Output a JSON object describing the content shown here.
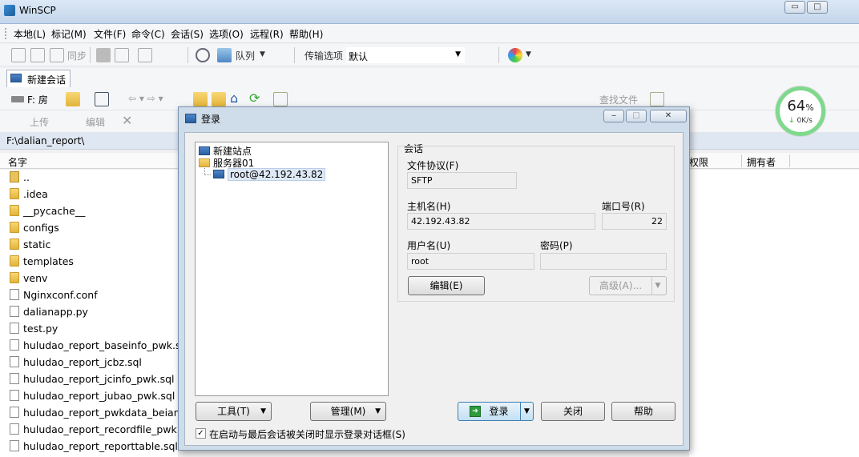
{
  "app": {
    "title": "WinSCP",
    "window_buttons": [
      "▭",
      "□"
    ]
  },
  "menu": [
    "本地(L)",
    "标记(M)",
    "文件(F)",
    "命令(C)",
    "会话(S)",
    "选项(O)",
    "远程(R)",
    "帮助(H)"
  ],
  "toolbar1": {
    "sync_label": "同步",
    "queue_label": "队列",
    "transfer_label": "传输选项",
    "transfer_value": "默认"
  },
  "tab": {
    "label": "新建会话"
  },
  "local_toolbar": {
    "drive": "F: 房"
  },
  "toolbar3": {
    "upload_label": "上传",
    "edit_label": "编辑"
  },
  "remote_toolbar": {
    "find_label": "查找文件"
  },
  "local": {
    "path": "F:\\dalian_report\\",
    "column_name": "名字",
    "files": [
      {
        "name": "..",
        "type": "up"
      },
      {
        "name": ".idea",
        "type": "folder"
      },
      {
        "name": "__pycache__",
        "type": "folder"
      },
      {
        "name": "configs",
        "type": "folder"
      },
      {
        "name": "static",
        "type": "folder"
      },
      {
        "name": "templates",
        "type": "folder"
      },
      {
        "name": "venv",
        "type": "folder"
      },
      {
        "name": "Nginxconf.conf",
        "type": "file"
      },
      {
        "name": "dalianapp.py",
        "type": "file"
      },
      {
        "name": "test.py",
        "type": "file"
      },
      {
        "name": "huludao_report_baseinfo_pwk.sql",
        "type": "file"
      },
      {
        "name": "huludao_report_jcbz.sql",
        "type": "file"
      },
      {
        "name": "huludao_report_jcinfo_pwk.sql",
        "type": "file"
      },
      {
        "name": "huludao_report_jubao_pwk.sql",
        "type": "file"
      },
      {
        "name": "huludao_report_pwkdata_beian.sql",
        "type": "file"
      },
      {
        "name": "huludao_report_recordfile_pwk.sql",
        "type": "file"
      },
      {
        "name": "huludao_report_reporttable.sql",
        "type": "file"
      }
    ]
  },
  "remote": {
    "column_perm": "权限",
    "column_owner": "拥有者"
  },
  "speed": {
    "percent": "64",
    "percent_sign": "%",
    "rate": "0K/s"
  },
  "dialog": {
    "title": "登录",
    "tree": {
      "new_site": "新建站点",
      "folder": "服务器01",
      "site": "root@42.192.43.82"
    },
    "session_label": "会话",
    "protocol_label": "文件协议(F)",
    "protocol_value": "SFTP",
    "host_label": "主机名(H)",
    "host_value": "42.192.43.82",
    "port_label": "端口号(R)",
    "port_value": "22",
    "user_label": "用户名(U)",
    "user_value": "root",
    "password_label": "密码(P)",
    "password_value": "",
    "edit_button": "编辑(E)",
    "advanced_button": "高级(A)...",
    "tools_button": "工具(T)",
    "manage_button": "管理(M)",
    "login_button": "登录",
    "close_button": "关闭",
    "help_button": "帮助",
    "startup_checkbox": "在启动与最后会话被关闭时显示登录对话框(S)",
    "startup_checked": true
  }
}
